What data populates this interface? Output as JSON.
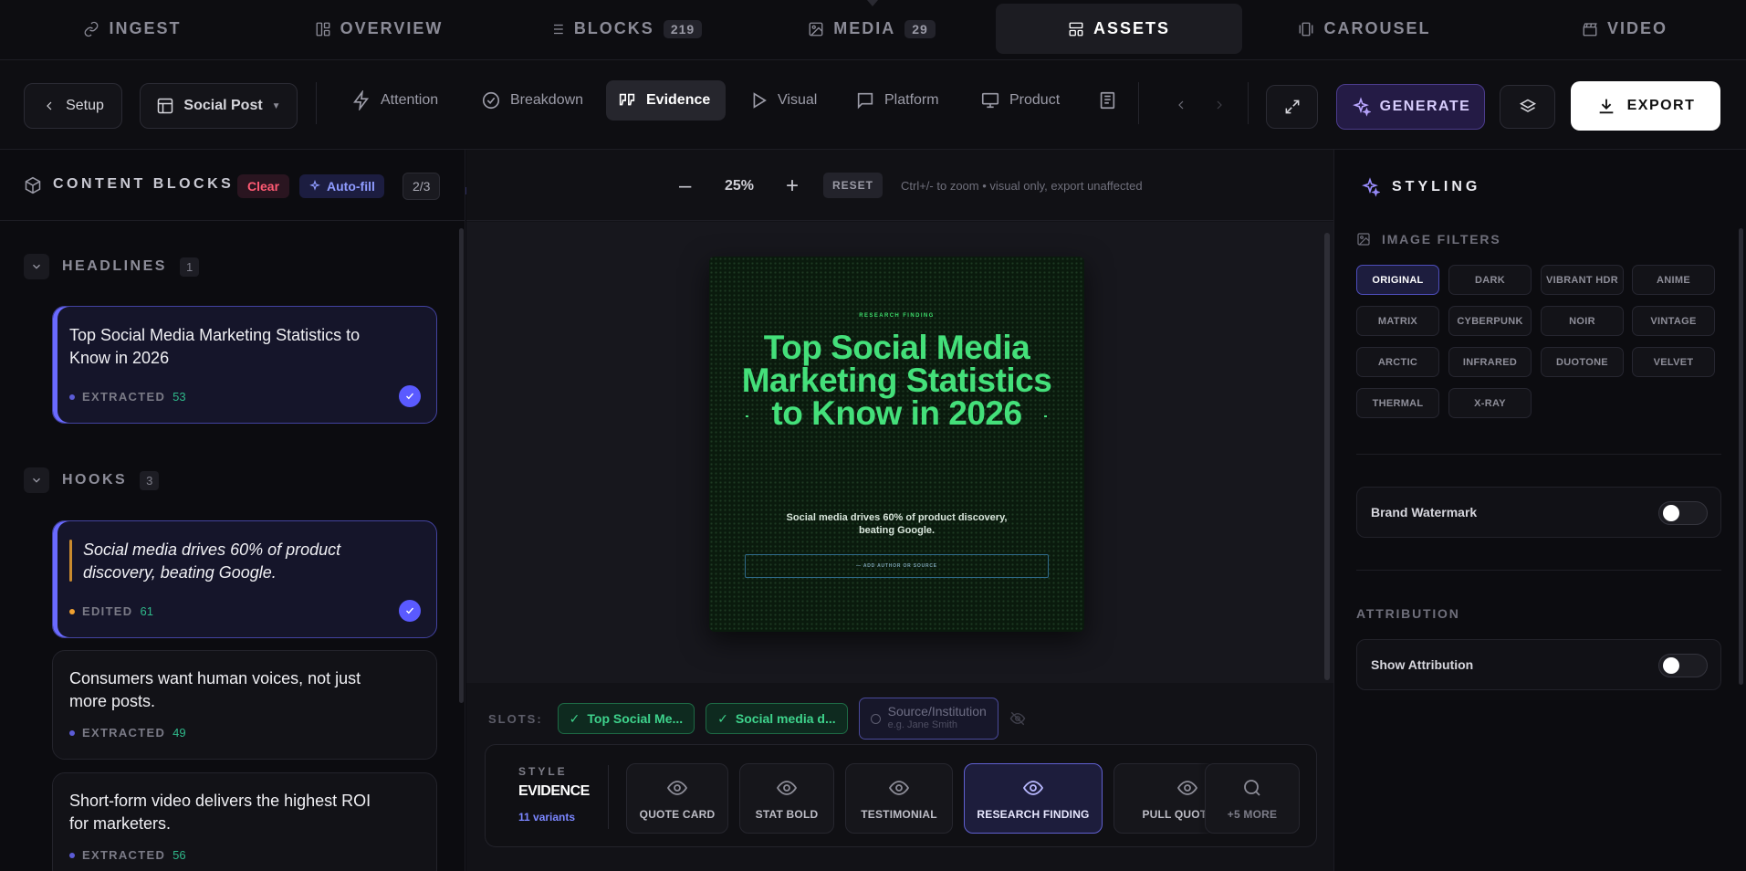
{
  "top_nav": {
    "tabs": [
      {
        "label": "INGEST",
        "icon": "link-icon"
      },
      {
        "label": "OVERVIEW",
        "icon": "layout-icon"
      },
      {
        "label": "BLOCKS",
        "icon": "list-icon",
        "count": "219"
      },
      {
        "label": "MEDIA",
        "icon": "image-icon",
        "count": "29"
      },
      {
        "label": "ASSETS",
        "icon": "template-icon",
        "active": true
      },
      {
        "label": "CAROUSEL",
        "icon": "carousel-icon"
      },
      {
        "label": "VIDEO",
        "icon": "clapper-icon"
      }
    ]
  },
  "toolbar": {
    "setup_label": "Setup",
    "format_label": "Social Post",
    "steps": [
      {
        "label": "Attention",
        "icon": "zap-icon"
      },
      {
        "label": "Breakdown",
        "icon": "check-circle-icon"
      },
      {
        "label": "Evidence",
        "icon": "quote-icon",
        "active": true
      },
      {
        "label": "Visual",
        "icon": "play-icon"
      },
      {
        "label": "Platform",
        "icon": "message-square-icon"
      },
      {
        "label": "Product",
        "icon": "monitor-icon"
      }
    ],
    "generate_label": "GENERATE",
    "export_label": "EXPORT"
  },
  "left_panel": {
    "title": "CONTENT BLOCKS",
    "clear_label": "Clear",
    "autofill_label": "Auto-fill",
    "progress": "2/3",
    "sections": [
      {
        "label": "HEADLINES",
        "count": "1",
        "cards": [
          {
            "text": "Top Social Media Marketing Statistics to Know in 2026",
            "status": "EXTRACTED",
            "score": "53",
            "selected": true
          }
        ]
      },
      {
        "label": "HOOKS",
        "count": "3",
        "cards": [
          {
            "text": "Social media drives 60% of product discovery, beating Google.",
            "status": "EDITED",
            "score": "61",
            "selected": true
          },
          {
            "text": "Consumers want human voices, not just more posts.",
            "status": "EXTRACTED",
            "score": "49"
          },
          {
            "text": "Short-form video delivers the highest ROI for marketers.",
            "status": "EXTRACTED",
            "score": "56"
          }
        ]
      }
    ]
  },
  "canvas": {
    "zoom_minus": "–",
    "zoom_plus": "+",
    "zoom": "25%",
    "reset_label": "RESET",
    "hint": "Ctrl+/- to zoom • visual only, export unaffected",
    "artboard": {
      "eyebrow": "RESEARCH FINDING",
      "title": "Top Social Media Marketing Statistics to Know in 2026",
      "subtitle": "Social media drives 60% of product discovery, beating Google.",
      "source_placeholder": "— ADD AUTHOR OR SOURCE",
      "accent": "#44e07a",
      "background": "#0a1a0d"
    }
  },
  "slots": {
    "label": "SLOTS:",
    "items": [
      {
        "text": "Top Social Me...",
        "filled": true
      },
      {
        "text": "Social media d...",
        "filled": true
      },
      {
        "text": "Source/Institution",
        "placeholder": "e.g. Jane Smith",
        "filled": false
      }
    ]
  },
  "style_bar": {
    "label": "STYLE",
    "name": "EVIDENCE",
    "variants_count": "11 variants",
    "variants": [
      {
        "label": "QUOTE CARD",
        "icon": "eye-icon"
      },
      {
        "label": "STAT BOLD",
        "icon": "eye-icon"
      },
      {
        "label": "TESTIMONIAL",
        "icon": "eye-icon"
      },
      {
        "label": "RESEARCH FINDING",
        "icon": "eye-icon",
        "active": true
      },
      {
        "label": "PULL QUOTE",
        "icon": "eye-icon"
      }
    ],
    "more_label": "+5 MORE"
  },
  "right_panel": {
    "title": "STYLING",
    "image_filters_label": "IMAGE FILTERS",
    "filters": [
      "ORIGINAL",
      "DARK",
      "VIBRANT HDR",
      "ANIME",
      "MATRIX",
      "CYBERPUNK",
      "NOIR",
      "VINTAGE",
      "ARCTIC",
      "INFRARED",
      "DUOTONE",
      "VELVET",
      "THERMAL",
      "X-RAY"
    ],
    "active_filter": "ORIGINAL",
    "brand_watermark_label": "Brand Watermark",
    "brand_watermark_on": false,
    "attribution_label": "ATTRIBUTION",
    "show_attribution_label": "Show Attribution",
    "show_attribution_on": false
  },
  "colors": {
    "accent_purple": "#5a5aff",
    "success_green": "#2fb88a",
    "danger_red": "#ff5a73",
    "edited_orange": "#f0a030"
  }
}
